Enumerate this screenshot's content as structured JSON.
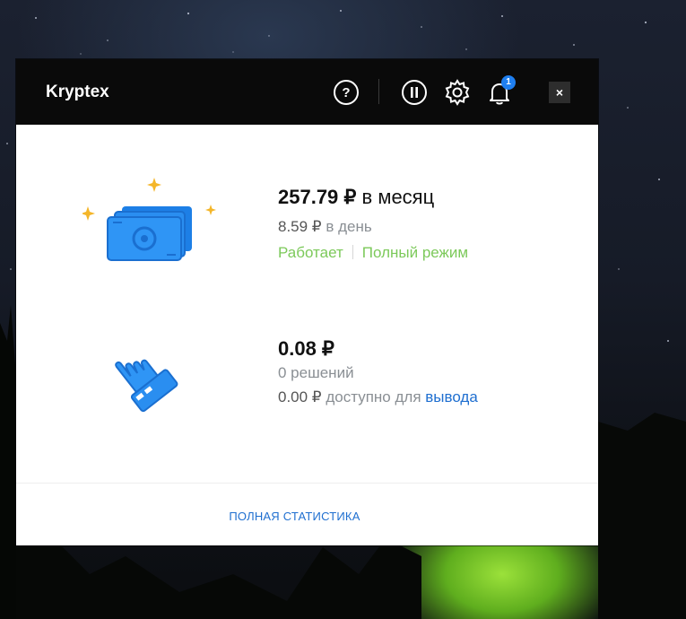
{
  "window": {
    "title": "Kryptex",
    "notification_count": "1",
    "close_label": "×"
  },
  "earnings": {
    "monthly_value": "257.79 ₽",
    "monthly_unit": " в месяц",
    "daily_value": "8.59 ₽",
    "daily_unit": " в день",
    "status": "Работает",
    "mode": "Полный режим"
  },
  "balance": {
    "value": "0.08 ₽",
    "solutions": "0 решений",
    "available_value": "0.00 ₽",
    "available_text": " доступно для ",
    "withdraw_link": "вывода"
  },
  "footer": {
    "full_stats_link": "ПОЛНАЯ СТАТИСТИКА"
  },
  "colors": {
    "status_green": "#7cc95a",
    "link_blue": "#1f6fd0",
    "illustration_blue": "#2a8ef0",
    "sparkle_yellow": "#f4b62a"
  }
}
